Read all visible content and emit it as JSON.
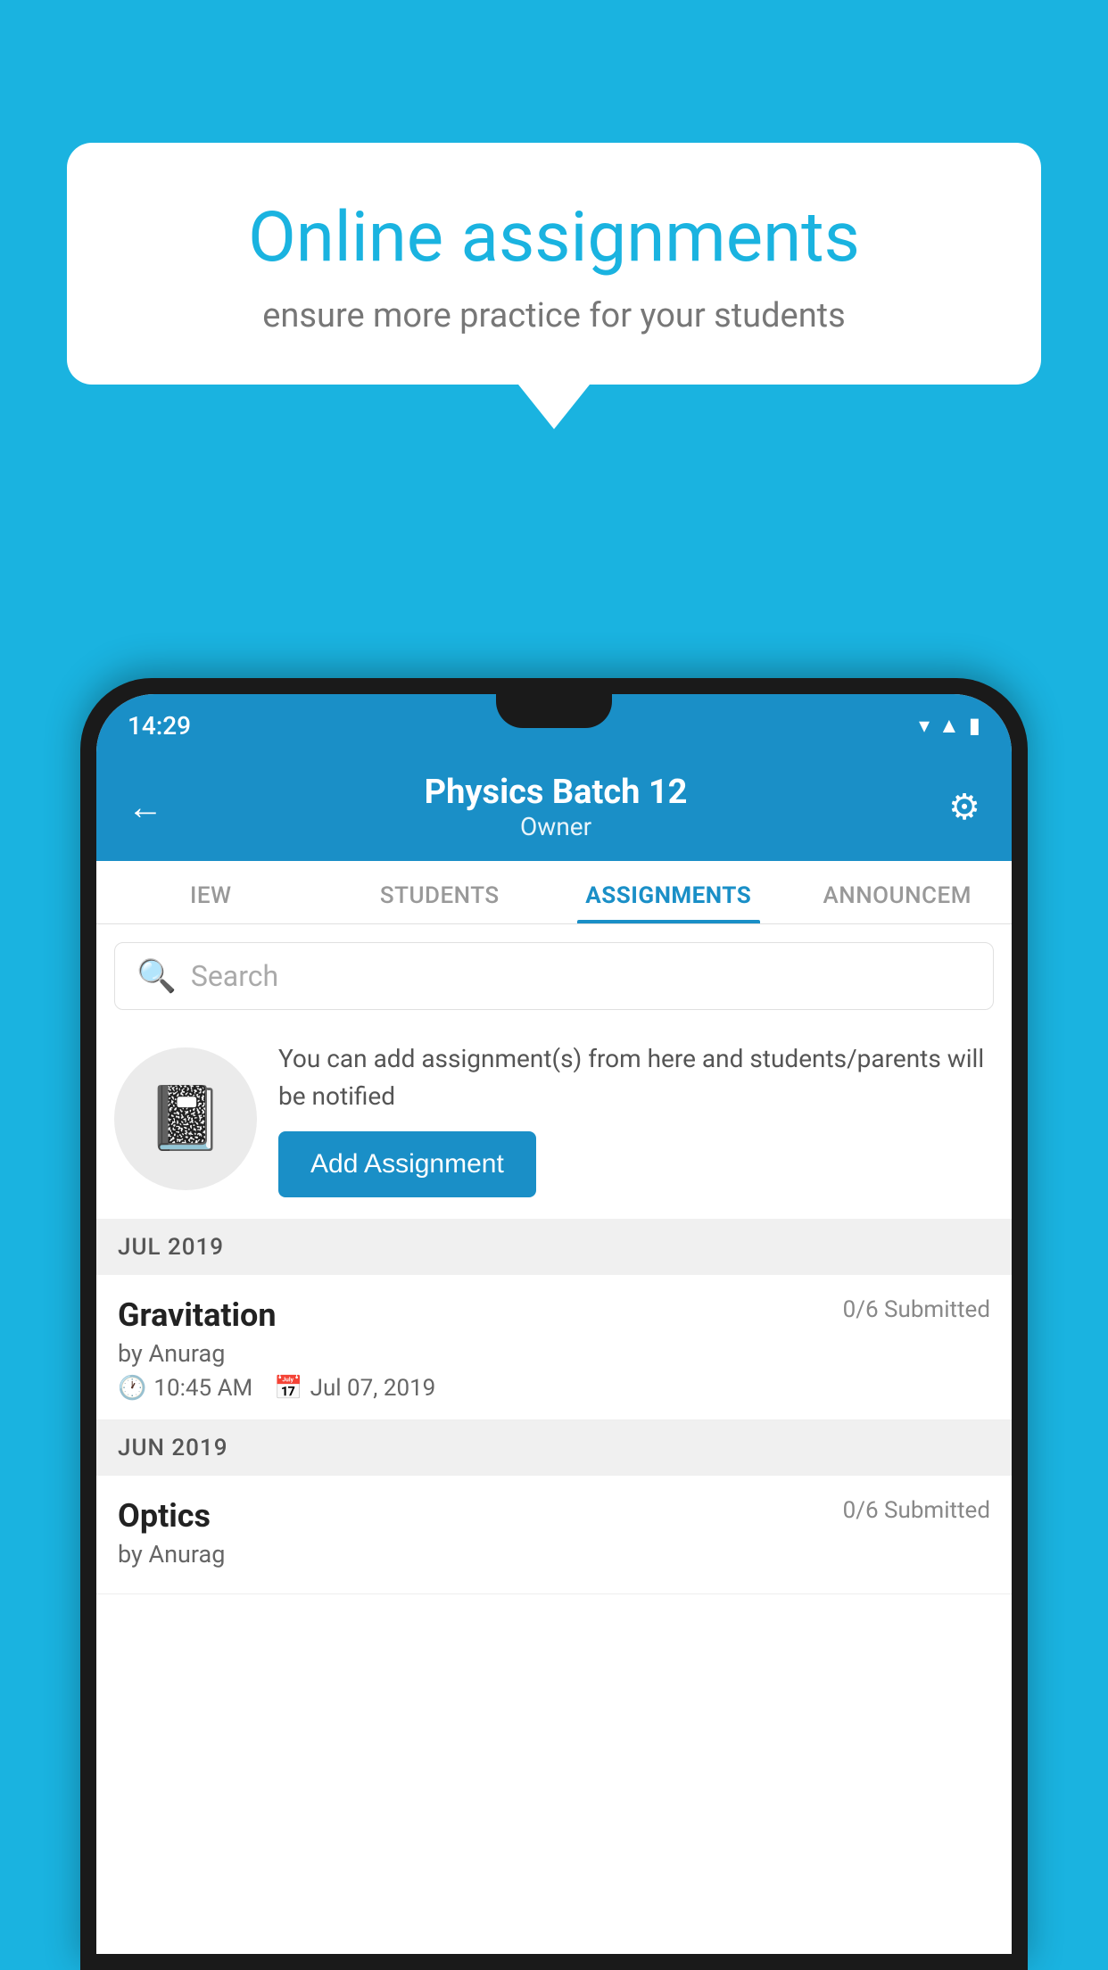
{
  "background_color": "#1ab3e0",
  "speech_bubble": {
    "title": "Online assignments",
    "subtitle": "ensure more practice for your students"
  },
  "phone": {
    "status_bar": {
      "time": "14:29",
      "icons": [
        "wifi",
        "signal",
        "battery"
      ]
    },
    "header": {
      "title": "Physics Batch 12",
      "subtitle": "Owner",
      "back_label": "←",
      "gear_label": "⚙"
    },
    "tabs": [
      {
        "label": "IEW",
        "active": false
      },
      {
        "label": "STUDENTS",
        "active": false
      },
      {
        "label": "ASSIGNMENTS",
        "active": true
      },
      {
        "label": "ANNOUNCEM",
        "active": false
      }
    ],
    "search": {
      "placeholder": "Search"
    },
    "promo": {
      "text": "You can add assignment(s) from here and students/parents will be notified",
      "button_label": "Add Assignment"
    },
    "sections": [
      {
        "label": "JUL 2019",
        "assignments": [
          {
            "name": "Gravitation",
            "submitted": "0/6 Submitted",
            "by": "by Anurag",
            "time": "10:45 AM",
            "date": "Jul 07, 2019"
          }
        ]
      },
      {
        "label": "JUN 2019",
        "assignments": [
          {
            "name": "Optics",
            "submitted": "0/6 Submitted",
            "by": "by Anurag",
            "time": "",
            "date": ""
          }
        ]
      }
    ]
  }
}
